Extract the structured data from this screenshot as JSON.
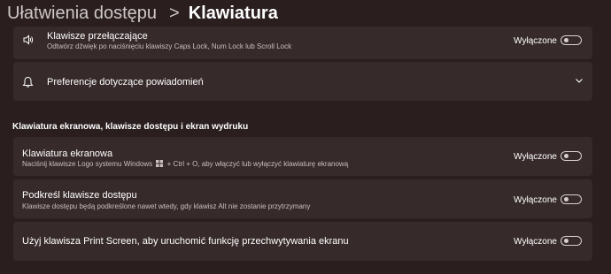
{
  "header": {
    "parent": "Ułatwienia dostępu",
    "separator": ">",
    "current": "Klawiatura"
  },
  "toggle_keys": {
    "title": "Klawisze przełączające",
    "description": "Odtwórz dźwięk po naciśnięciu klawiszy Caps Lock, Num Lock lub Scroll Lock",
    "state": "Wyłączone",
    "icon": "speaker-icon"
  },
  "notifications": {
    "title": "Preferencje dotyczące powiadomień",
    "icon": "bell-icon"
  },
  "section": {
    "title": "Klawiatura ekranowa, klawisze dostępu i ekran wydruku"
  },
  "onscreen_keyboard": {
    "title": "Klawiatura ekranowa",
    "description_before": "Naciśnij klawisze Logo systemu Windows",
    "description_after": "+ Ctrl + O, aby włączyć lub wyłączyć klawiaturę ekranową",
    "state": "Wyłączone"
  },
  "access_keys": {
    "title": "Podkreśl klawisze dostępu",
    "description": "Klawisze dostępu będą podkreślone nawet wtedy, gdy klawisz Alt nie zostanie przytrzymany",
    "state": "Wyłączone"
  },
  "print_screen": {
    "title": "Użyj klawisza Print Screen, aby uruchomić funkcję przechwytywania ekranu",
    "state": "Wyłączone"
  },
  "colors": {
    "background": "#2a1e1f",
    "card": "#372a2b",
    "toggle_off": "#d8d0d0"
  }
}
